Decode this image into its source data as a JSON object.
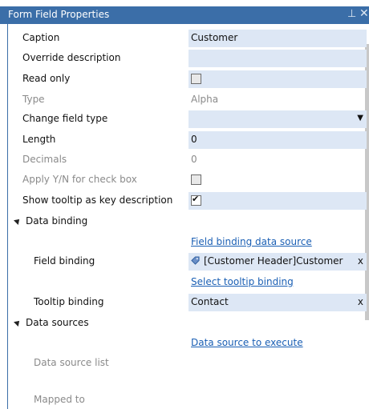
{
  "window": {
    "title": "Form Field Properties"
  },
  "fields": {
    "caption": {
      "label": "Caption",
      "value": "Customer"
    },
    "override_description": {
      "label": "Override description",
      "value": ""
    },
    "read_only": {
      "label": "Read only",
      "checked": false
    },
    "type": {
      "label": "Type",
      "value": "Alpha"
    },
    "change_field_type": {
      "label": "Change field type",
      "value": ""
    },
    "length": {
      "label": "Length",
      "value": "0"
    },
    "decimals": {
      "label": "Decimals",
      "value": "0"
    },
    "apply_yn": {
      "label": "Apply Y/N for check box",
      "checked": false
    },
    "show_tooltip": {
      "label": "Show tooltip as key description",
      "checked": true
    }
  },
  "data_binding": {
    "section_label": "Data binding",
    "field_binding_source_link": "Field binding data source",
    "field_binding": {
      "label": "Field binding",
      "value": "[Customer Header]Customer",
      "clear": "x"
    },
    "select_tooltip_link": "Select tooltip binding",
    "tooltip_binding": {
      "label": "Tooltip binding",
      "value": "Contact",
      "clear": "x"
    }
  },
  "data_sources": {
    "section_label": "Data sources",
    "execute_link": "Data source to execute",
    "data_source_list": {
      "label": "Data source list"
    },
    "mapped_to": {
      "label": "Mapped to"
    }
  },
  "icons": {
    "pin": "pin-icon",
    "close": "close-icon",
    "collapse": "collapse-triangle-icon",
    "dropdown": "dropdown-arrow-icon",
    "tag": "tag-icon"
  },
  "colors": {
    "title_bar": "#3b6ea8",
    "value_bg": "#dde7f5",
    "link": "#1a5fb4"
  }
}
